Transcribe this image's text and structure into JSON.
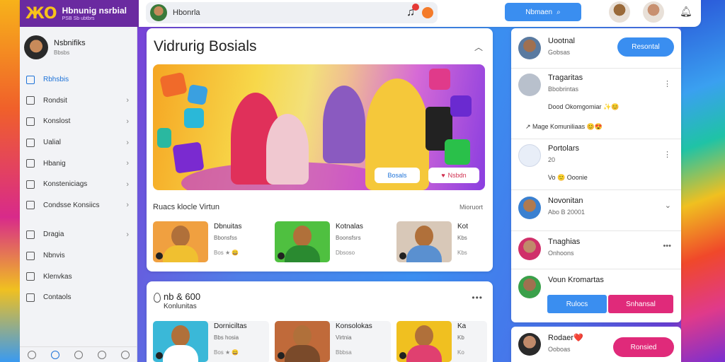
{
  "brand": {
    "logo": "ЖO",
    "title": "Hbnunig nsrbial",
    "subtitle": "PSB Sb ubtbrs"
  },
  "search": {
    "text": "Hbonrla",
    "right_icons": [
      "music-icon",
      "emoji-icon"
    ]
  },
  "top_button": {
    "label": "Nbmaen"
  },
  "sidebar": {
    "profile_name": "Nsbnifiks",
    "profile_sub": "Bbsbs",
    "items": [
      {
        "label": "Rbhsbis",
        "active": true,
        "chevron": false
      },
      {
        "label": "Rondsit",
        "active": false,
        "chevron": true
      },
      {
        "label": "Konslost",
        "active": false,
        "chevron": true
      },
      {
        "label": "Ualial",
        "active": false,
        "chevron": true
      },
      {
        "label": "Hbanig",
        "active": false,
        "chevron": true
      },
      {
        "label": "Konsteniciags",
        "active": false,
        "chevron": true
      },
      {
        "label": "Condsse Konsiics",
        "active": false,
        "chevron": true
      },
      {
        "label": "Dragia",
        "active": false,
        "chevron": true
      },
      {
        "label": "Nbnvis",
        "active": false,
        "chevron": false
      },
      {
        "label": "Klenvkas",
        "active": false,
        "chevron": false
      },
      {
        "label": "Contaols",
        "active": false,
        "chevron": false
      }
    ]
  },
  "main": {
    "title": "Vidrurig Bosials",
    "banner": {
      "btn1": "Bosals",
      "btn2": "Nsbdn"
    },
    "section_title": "Ruacs klocle Virtun",
    "section_more": "Mioruort",
    "cards": [
      {
        "title": "Dbnuitas",
        "sub": "Bbonsfss",
        "meta": "Bos ★ 😀",
        "thumb": "#f0a040",
        "body": "#f0c030"
      },
      {
        "title": "Kotnalas",
        "sub": "Boonsfsrs",
        "meta": "Dbsoso",
        "thumb": "#4fc040",
        "body": "#2a8a30"
      },
      {
        "title": "Kot",
        "sub": "Kbs",
        "meta": "Kbs",
        "thumb": "#d8c8b8",
        "body": "#5a90d0"
      }
    ]
  },
  "panel2": {
    "title": "nb & 600",
    "sub": "Konlunitas",
    "cards": [
      {
        "title": "Dorniciltas",
        "sub": "Bbs hosia",
        "meta": "Bos ★ 😀",
        "thumb": "#3ab8d8",
        "body": "#fff"
      },
      {
        "title": "Konsolokas",
        "sub": "Virtnia",
        "meta": "Bbbsa",
        "thumb": "#c06a3a",
        "body": "#7a4a2a"
      },
      {
        "title": "Ka",
        "sub": "Kb",
        "meta": "Ko",
        "thumb": "#f0c020",
        "body": "#e04070"
      }
    ]
  },
  "right": {
    "contact1": {
      "name": "Uootnal",
      "sub": "Gobsas",
      "button": "Resontal"
    },
    "contact2": {
      "name": "Tragaritas",
      "sub": "Bbobrintas"
    },
    "line1": "Dood Okomgomiar ✨😊",
    "line2": "Mage Komuniliaas 😊😍",
    "contact3": {
      "name": "Portolars",
      "sub": "20"
    },
    "line3": "Vo 🙂 Ooonie",
    "contact4": {
      "name": "Novonitan",
      "sub": "Abo B 20001"
    },
    "contact5": {
      "name": "Tnaghias",
      "sub": "Onhoons"
    },
    "contact6": {
      "name": "Voun Kromartas",
      "btn_left": "Rulocs",
      "btn_right": "Snhansal"
    },
    "contact7": {
      "name": "Rodaer❤️",
      "sub": "Ooboas",
      "button": "Ronsied"
    }
  },
  "colors": {
    "accent": "#3a8ef0",
    "pink": "#e02a7a",
    "brand_purple": "#6a2aa0"
  }
}
